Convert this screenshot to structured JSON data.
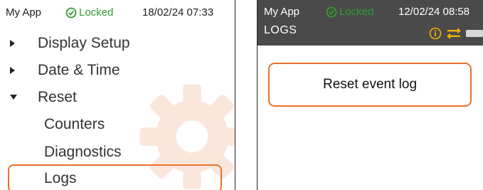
{
  "screen1": {
    "status": {
      "app": "My App",
      "lock": "Locked",
      "datetime": "18/02/24 07:33"
    },
    "menu": [
      {
        "label": "Display Setup",
        "expanded": false
      },
      {
        "label": "Date & Time",
        "expanded": false
      },
      {
        "label": "Reset",
        "expanded": true
      },
      {
        "label": "Counters"
      },
      {
        "label": "Diagnostics"
      },
      {
        "label": "Logs",
        "selected": true
      }
    ]
  },
  "screen2": {
    "status": {
      "app": "My App",
      "lock": "Locked",
      "datetime": "12/02/24 08:58"
    },
    "title": "LOGS",
    "button": "Reset event log",
    "status_icons": [
      "info-icon",
      "transfer-icon",
      "battery-icon"
    ]
  },
  "colors": {
    "accent": "#e8722a",
    "locked": "#2e9d2e",
    "gear": "#fbe6dc",
    "status_dark": "#4a4a4a"
  }
}
